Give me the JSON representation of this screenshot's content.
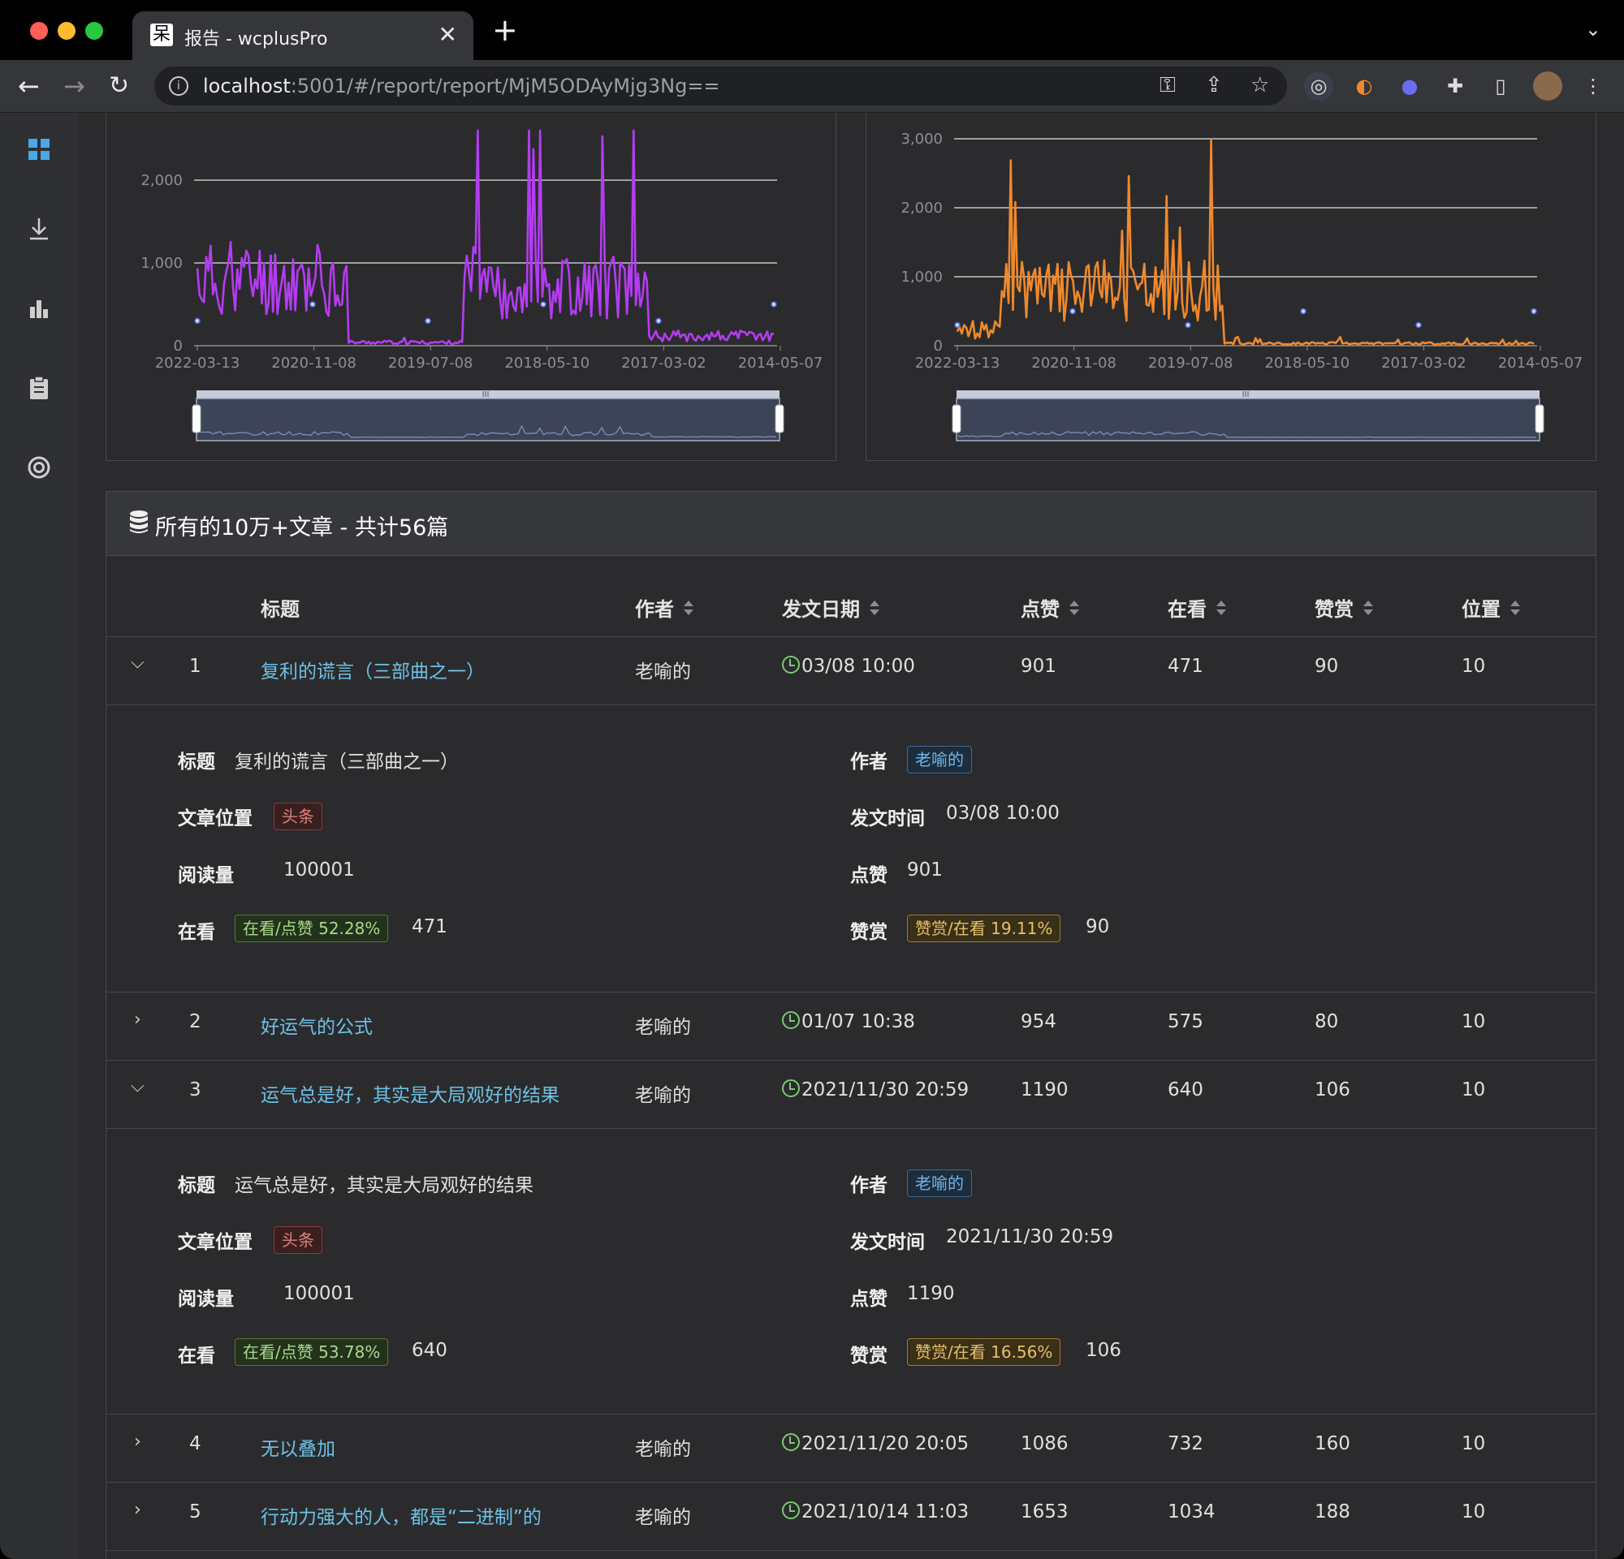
{
  "browser": {
    "tab_favicon": "呆",
    "tab_title": "报告 - wcplusPro",
    "tab_close": "✕",
    "new_tab": "+",
    "url_host": "localhost",
    "url_rest": ":5001/#/report/report/MjM5ODAyMjg3Ng=="
  },
  "sidebar": {
    "items": [
      "dashboard-icon",
      "download-icon",
      "bar-chart-icon",
      "clipboard-icon",
      "lifebuoy-icon"
    ],
    "accent": "#4aa8e8"
  },
  "charts": {
    "left": {
      "color": "#b43cf2",
      "y_ticks": [
        "0",
        "1,000",
        "2,000"
      ],
      "x_ticks": [
        "2022-03-13",
        "2020-11-08",
        "2019-07-08",
        "2018-05-10",
        "2017-03-02",
        "2014-05-07"
      ]
    },
    "right": {
      "color": "#f0892b",
      "y_ticks": [
        "0",
        "1,000",
        "2,000",
        "3,000"
      ],
      "x_ticks": [
        "2022-03-13",
        "2020-11-08",
        "2019-07-08",
        "2018-05-10",
        "2017-03-02",
        "2014-05-07"
      ]
    },
    "slider_handle": "III"
  },
  "panel": {
    "title": "所有的10万+文章 - 共计56篇"
  },
  "table": {
    "headers": {
      "title": "标题",
      "author": "作者",
      "date": "发文日期",
      "likes": "点赞",
      "watching": "在看",
      "reward": "赞赏",
      "position": "位置"
    },
    "rows": [
      {
        "index": "1",
        "title": "复利的谎言（三部曲之一）",
        "author": "老喻的",
        "date": "03/08 10:00",
        "likes": "901",
        "watching": "471",
        "reward": "90",
        "position": "10",
        "expand_icon": "chevron-down"
      },
      {
        "index": "2",
        "title": "好运气的公式",
        "author": "老喻的",
        "date": "01/07 10:38",
        "likes": "954",
        "watching": "575",
        "reward": "80",
        "position": "10",
        "expand_icon": "chevron-right"
      },
      {
        "index": "3",
        "title": "运气总是好，其实是大局观好的结果",
        "author": "老喻的",
        "date": "2021/11/30 20:59",
        "likes": "1190",
        "watching": "640",
        "reward": "106",
        "position": "10",
        "expand_icon": "chevron-down"
      },
      {
        "index": "4",
        "title": "无以叠加",
        "author": "老喻的",
        "date": "2021/11/20 20:05",
        "likes": "1086",
        "watching": "732",
        "reward": "160",
        "position": "10",
        "expand_icon": "chevron-right"
      },
      {
        "index": "5",
        "title": "行动力强大的人，都是“二进制”的",
        "author": "老喻的",
        "date": "2021/10/14 11:03",
        "likes": "1653",
        "watching": "1034",
        "reward": "188",
        "position": "10",
        "expand_icon": "chevron-right"
      }
    ],
    "detail_labels": {
      "title": "标题",
      "author": "作者",
      "position": "文章位置",
      "time": "发文时间",
      "reads": "阅读量",
      "likes": "点赞",
      "watching": "在看",
      "reward": "赞赏"
    },
    "details": [
      {
        "title": "复利的谎言（三部曲之一）",
        "author_tag": "老喻的",
        "position_tag": "头条",
        "time": "03/08 10:00",
        "reads": "100001",
        "likes": "901",
        "watching_tag": "在看/点赞 52.28%",
        "watching": "471",
        "reward_tag": "赞赏/在看 19.11%",
        "reward": "90"
      },
      {
        "title": "运气总是好，其实是大局观好的结果",
        "author_tag": "老喻的",
        "position_tag": "头条",
        "time": "2021/11/30 20:59",
        "reads": "100001",
        "likes": "1190",
        "watching_tag": "在看/点赞 53.78%",
        "watching": "640",
        "reward_tag": "赞赏/在看 16.56%",
        "reward": "106"
      }
    ]
  }
}
